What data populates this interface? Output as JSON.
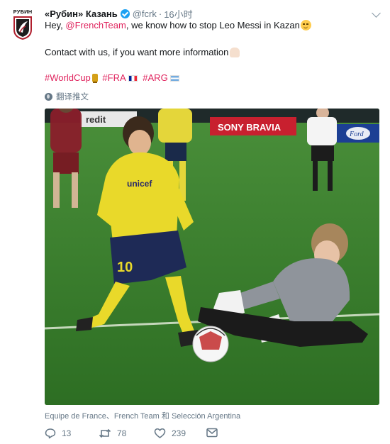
{
  "avatar": {
    "brand_text": "РУБИН",
    "icon": "rubin-crest-logo"
  },
  "tweet": {
    "display_name": "«Рубин» Казань",
    "verified_icon": "verified-badge-icon",
    "handle": "@fcrk",
    "separator": "·",
    "time": "16小时",
    "line1_pre": "Hey, ",
    "mention": "@FrenchTeam",
    "line1_post": ", we know how to stop Leo Messi in Kazan",
    "line2": "Contact with us, if you want more information",
    "hashtags": [
      "#WorldCup",
      "#FRA",
      "#ARG"
    ],
    "translate_label": "翻译推文",
    "photo_caption": "Equipe de France、French Team 和 Selección Argentina",
    "photo_ad_boards": [
      "redit",
      "SONY BRAVIA",
      "Ford"
    ]
  },
  "actions": {
    "reply_count": "13",
    "retweet_count": "78",
    "like_count": "239"
  },
  "colors": {
    "accent": "#e0245e",
    "muted": "#657786",
    "verified": "#1da1f2"
  }
}
